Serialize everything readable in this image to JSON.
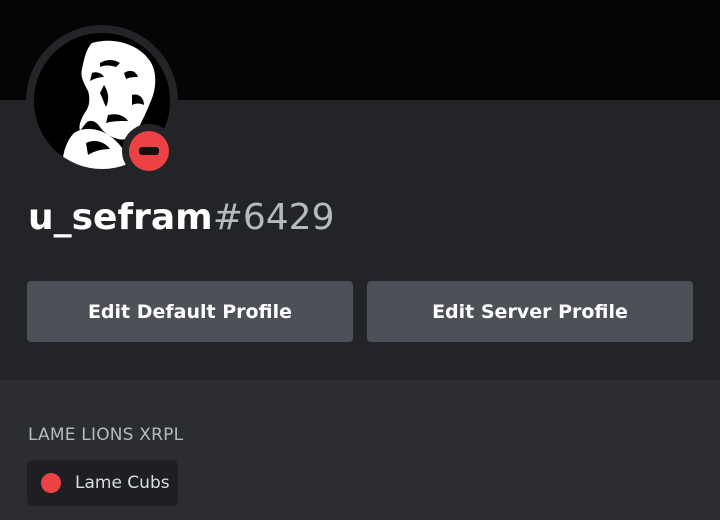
{
  "profile": {
    "username": "u_sefram",
    "discriminator": "#6429",
    "status": "do-not-disturb",
    "status_color": "#ed4245",
    "avatar_icon": "user-avatar-portrait"
  },
  "actions": {
    "edit_default_label": "Edit Default Profile",
    "edit_server_label": "Edit Server Profile"
  },
  "server": {
    "name": "LAME LIONS XRPL",
    "roles": [
      {
        "name": "Lame Cubs",
        "color": "#ed4245"
      }
    ]
  },
  "colors": {
    "banner": "#050505",
    "card": "#232428",
    "background": "#2b2d31",
    "button": "#4e5058"
  }
}
